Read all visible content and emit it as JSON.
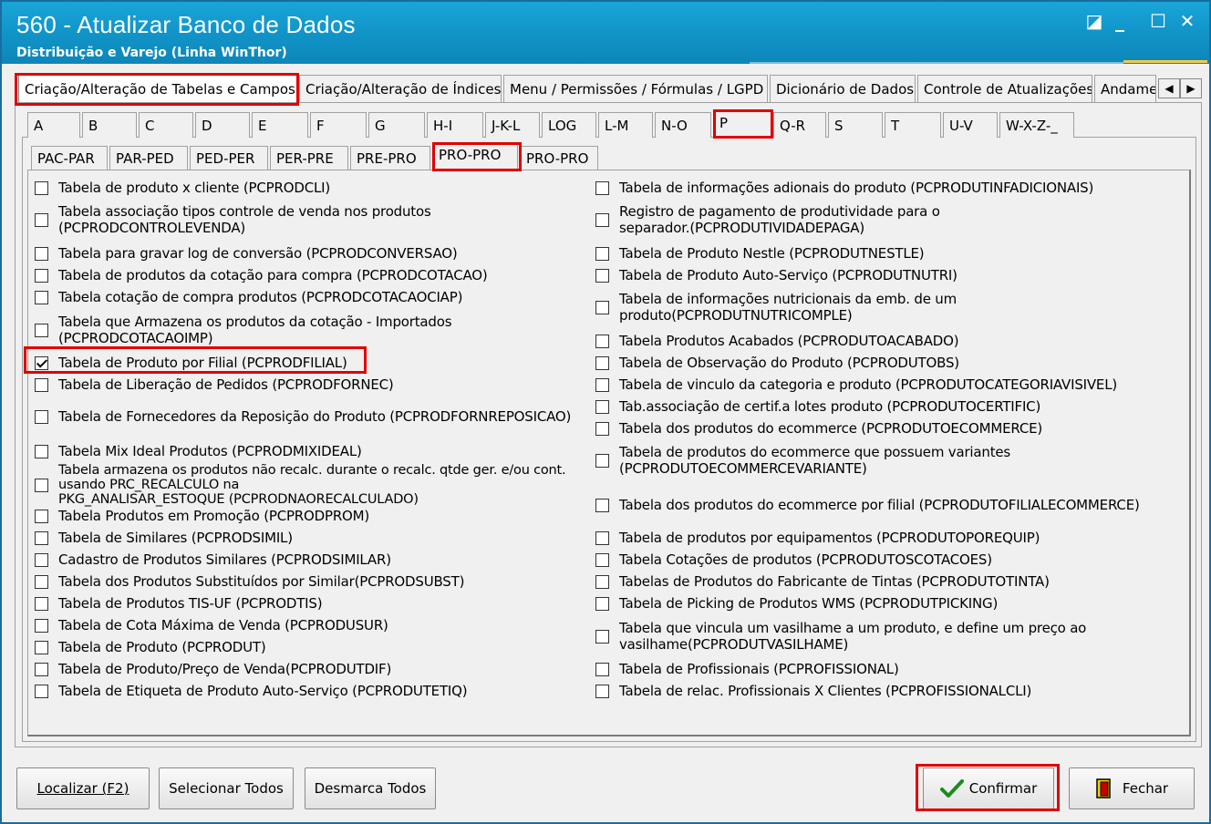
{
  "window": {
    "title": "560 - Atualizar Banco de Dados",
    "subtitle": "Distribuição e Varejo (Linha WinThor)"
  },
  "controls": {
    "restore_glyph": "◪",
    "minimize_glyph": "_",
    "maximize_glyph": "☐",
    "close_glyph": "✕",
    "scroll_left": "◀",
    "scroll_right": "▶"
  },
  "main_tabs": [
    "Criação/Alteração de Tabelas e Campos",
    "Criação/Alteração de Índices",
    "Menu / Permissões / Fórmulas / LGPD",
    "Dicionário de Dados",
    "Controle de Atualizações",
    "Andame"
  ],
  "letter_tabs": [
    "A",
    "B",
    "C",
    "D",
    "E",
    "F",
    "G",
    "H-I",
    "J-K-L",
    "LOG",
    "L-M",
    "N-O",
    "P",
    "Q-R",
    "S",
    "T",
    "U-V",
    "W-X-Z-_"
  ],
  "sub_tabs": [
    "PAC-PAR",
    "PAR-PED",
    "PED-PER",
    "PER-PRE",
    "PRE-PRO",
    "PRO-PRO",
    "PRO-PRO"
  ],
  "left_items": [
    {
      "label": "Tabela de produto x cliente (PCPRODCLI)",
      "checked": false
    },
    {
      "label": "Tabela associação tipos controle de venda nos produtos\n(PCPRODCONTROLEVENDA)",
      "checked": false
    },
    {
      "label": "Tabela para gravar log de conversão (PCPRODCONVERSAO)",
      "checked": false
    },
    {
      "label": "Tabela de produtos da cotação para compra (PCPRODCOTACAO)",
      "checked": false
    },
    {
      "label": "Tabela cotação de compra produtos (PCPRODCOTACAOCIAP)",
      "checked": false
    },
    {
      "label": "Tabela que Armazena os produtos da cotação - Importados\n(PCPRODCOTACAOIMP)",
      "checked": false
    },
    {
      "label": "Tabela de Produto por Filial (PCPRODFILIAL)",
      "checked": true
    },
    {
      "label": "Tabela de Liberação de Pedidos (PCPRODFORNEC)",
      "checked": false
    },
    {
      "label": "Tabela de Fornecedores da Reposição do Produto (PCPRODFORNREPOSICAO)",
      "checked": false
    },
    {
      "label": "Tabela Mix Ideal Produtos (PCPRODMIXIDEAL)",
      "checked": false
    },
    {
      "label": "Tabela armazena os produtos não recalc. durante o recalc. qtde ger. e/ou cont.\nusando PRC_RECALCULO na\nPKG_ANALISAR_ESTOQUE (PCPRODNAORECALCULADO)",
      "checked": false
    },
    {
      "label": "Tabela Produtos em Promoção (PCPRODPROM)",
      "checked": false
    },
    {
      "label": "Tabela de Similares (PCPRODSIMIL)",
      "checked": false
    },
    {
      "label": "Cadastro de Produtos Similares (PCPRODSIMILAR)",
      "checked": false
    },
    {
      "label": "Tabela dos Produtos Substituídos por Similar(PCPRODSUBST)",
      "checked": false
    },
    {
      "label": "Tabela de Produtos TIS-UF (PCPRODTIS)",
      "checked": false
    },
    {
      "label": "Tabela de Cota Máxima de Venda (PCPRODUSUR)",
      "checked": false
    },
    {
      "label": "Tabela de Produto (PCPRODUT)",
      "checked": false
    },
    {
      "label": "Tabela de Produto/Preço de Venda(PCPRODUTDIF)",
      "checked": false
    },
    {
      "label": "Tabela de Etiqueta de Produto Auto-Serviço (PCPRODUTETIQ)",
      "checked": false
    }
  ],
  "right_items": [
    {
      "label": "Tabela de informações adionais do produto (PCPRODUTINFADICIONAIS)",
      "checked": false
    },
    {
      "label": "Registro de pagamento de produtividade para o\nseparador.(PCPRODUTIVIDADEPAGA)",
      "checked": false
    },
    {
      "label": "Tabela de Produto Nestle (PCPRODUTNESTLE)",
      "checked": false
    },
    {
      "label": "Tabela de Produto Auto-Serviço (PCPRODUTNUTRI)",
      "checked": false
    },
    {
      "label": "Tabela de informações nutricionais da emb. de um\nproduto(PCPRODUTNUTRICOMPLE)",
      "checked": false
    },
    {
      "label": "Tabela Produtos Acabados (PCPRODUTOACABADO)",
      "checked": false
    },
    {
      "label": "Tabela de Observação do Produto (PCPRODUTOBS)",
      "checked": false
    },
    {
      "label": "Tabela de vinculo da categoria e produto (PCPRODUTOCATEGORIAVISIVEL)",
      "checked": false
    },
    {
      "label": "Tab.associação de certif.a lotes produto (PCPRODUTOCERTIFIC)",
      "checked": false
    },
    {
      "label": "Tabela dos produtos do ecommerce (PCPRODUTOECOMMERCE)",
      "checked": false
    },
    {
      "label": "Tabela de produtos do ecommerce que possuem variantes\n(PCPRODUTOECOMMERCEVARIANTE)",
      "checked": false
    },
    {
      "label": "Tabela dos produtos do ecommerce por filial (PCPRODUTOFILIALECOMMERCE)",
      "checked": false
    },
    {
      "label": "Tabela de produtos por equipamentos (PCPRODUTOPOREQUIP)",
      "checked": false
    },
    {
      "label": "Tabela Cotações de produtos (PCPRODUTOSCOTACOES)",
      "checked": false
    },
    {
      "label": "Tabelas de Produtos do Fabricante de Tintas (PCPRODUTOTINTA)",
      "checked": false
    },
    {
      "label": "Tabela de Picking de Produtos WMS (PCPRODUTPICKING)",
      "checked": false
    },
    {
      "label": "Tabela que vincula um vasilhame a um produto, e define um preço ao\nvasilhame(PCPRODUTVASILHAME)",
      "checked": false
    },
    {
      "label": "Tabela de Profissionais (PCPROFISSIONAL)",
      "checked": false
    },
    {
      "label": "Tabela de relac. Profissionais X Clientes (PCPROFISSIONALCLI)",
      "checked": false
    }
  ],
  "buttons": {
    "localizar": "Localizar (F2)",
    "selecionar": "Selecionar Todos",
    "desmarca": "Desmarca Todos",
    "confirmar": "Confirmar",
    "fechar": "Fechar"
  },
  "colors": {
    "title_bar": "#1093c7",
    "highlight": "#e00000"
  }
}
